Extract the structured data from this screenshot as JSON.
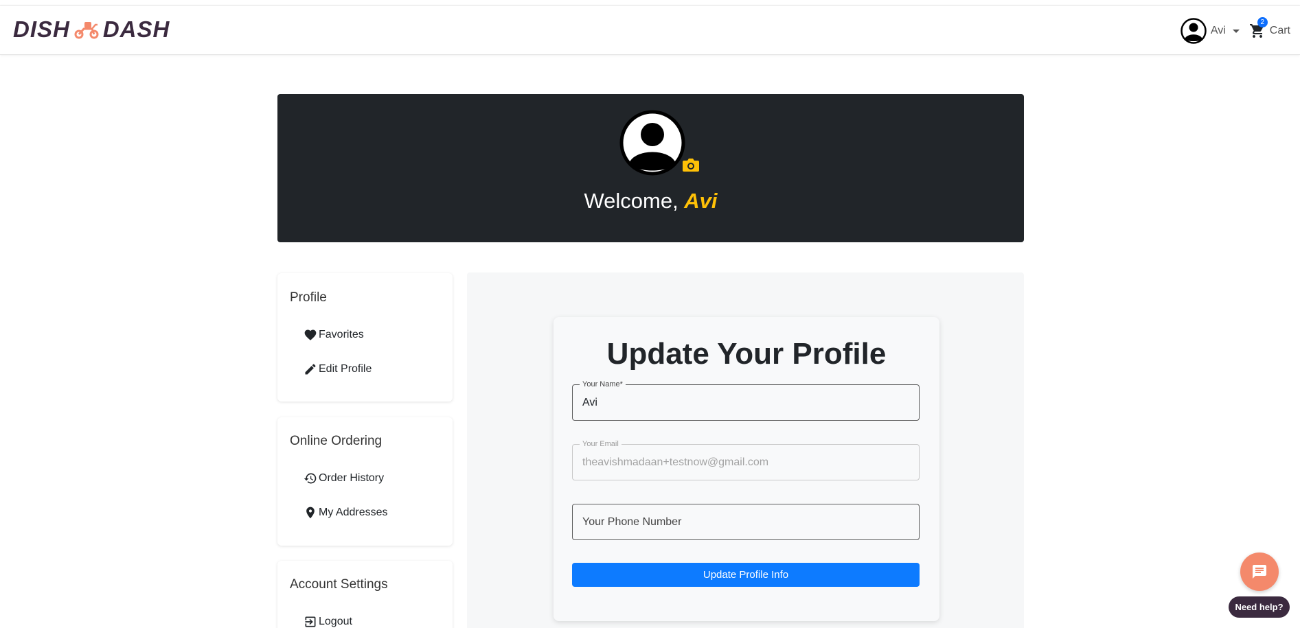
{
  "navbar": {
    "logo_left": "DISH",
    "logo_right": "DASH",
    "user_name": "Avi",
    "cart_count": "2",
    "cart_label": "Cart"
  },
  "hero": {
    "welcome_prefix": "Welcome, ",
    "welcome_name": "Avi"
  },
  "sidebar": {
    "sections": [
      {
        "title": "Profile",
        "items": [
          {
            "label": "Favorites",
            "icon": "heart-icon"
          },
          {
            "label": "Edit Profile",
            "icon": "pencil-icon"
          }
        ]
      },
      {
        "title": "Online Ordering",
        "items": [
          {
            "label": "Order History",
            "icon": "history-icon"
          },
          {
            "label": "My Addresses",
            "icon": "location-pin-icon"
          }
        ]
      },
      {
        "title": "Account Settings",
        "items": [
          {
            "label": "Logout",
            "icon": "logout-icon"
          }
        ]
      }
    ]
  },
  "form": {
    "title": "Update Your Profile",
    "name_label": "Your Name*",
    "name_value": "Avi",
    "email_label": "Your Email",
    "email_value": "theavishmadaan+testnow@gmail.com",
    "phone_placeholder": "Your Phone Number",
    "submit_label": "Update Profile Info"
  },
  "support": {
    "help_label": "Need help?"
  },
  "colors": {
    "accent_yellow": "#ffc107",
    "hero_bg": "#212529",
    "primary_blue": "#0d7bff",
    "chat_orange": "#f4896b",
    "brand_dark": "#3b2a3f"
  }
}
